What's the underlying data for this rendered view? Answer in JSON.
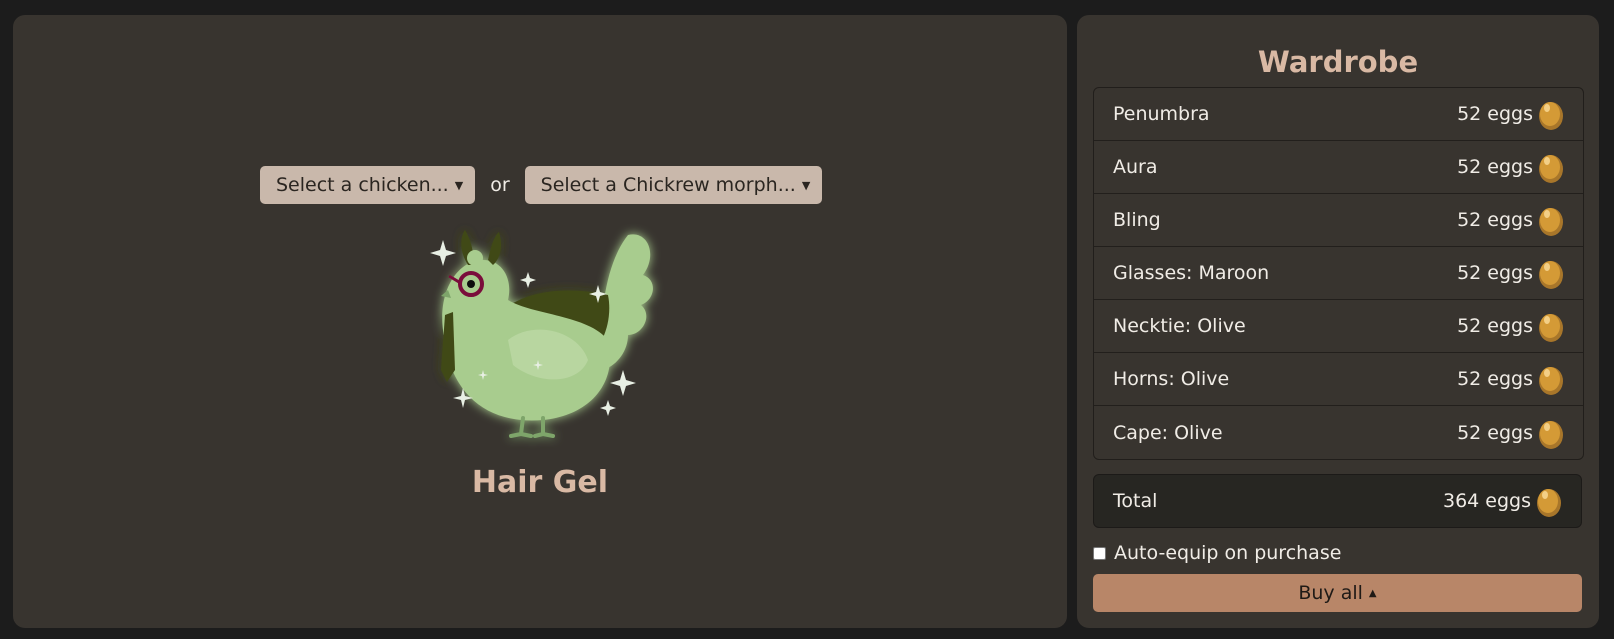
{
  "selectors": {
    "chicken_label": "Select a chicken...",
    "or_text": "or",
    "morph_label": "Select a Chickrew morph..."
  },
  "chicken": {
    "name": "Hair Gel",
    "body_color": "#a8cc8e",
    "accent_color": "#404a18",
    "glasses_color": "#7a0a3a"
  },
  "wardrobe": {
    "title": "Wardrobe",
    "items": [
      {
        "name": "Penumbra",
        "price": "52 eggs"
      },
      {
        "name": "Aura",
        "price": "52 eggs"
      },
      {
        "name": "Bling",
        "price": "52 eggs"
      },
      {
        "name": "Glasses: Maroon",
        "price": "52 eggs"
      },
      {
        "name": "Necktie: Olive",
        "price": "52 eggs"
      },
      {
        "name": "Horns: Olive",
        "price": "52 eggs"
      },
      {
        "name": "Cape: Olive",
        "price": "52 eggs"
      }
    ],
    "total_label": "Total",
    "total_price": "364 eggs",
    "auto_equip_label": "Auto-equip on purchase",
    "buy_all_label": "Buy all",
    "currency_icon": "egg-icon",
    "accent_color": "#b88668",
    "title_color": "#d9b9a4"
  }
}
